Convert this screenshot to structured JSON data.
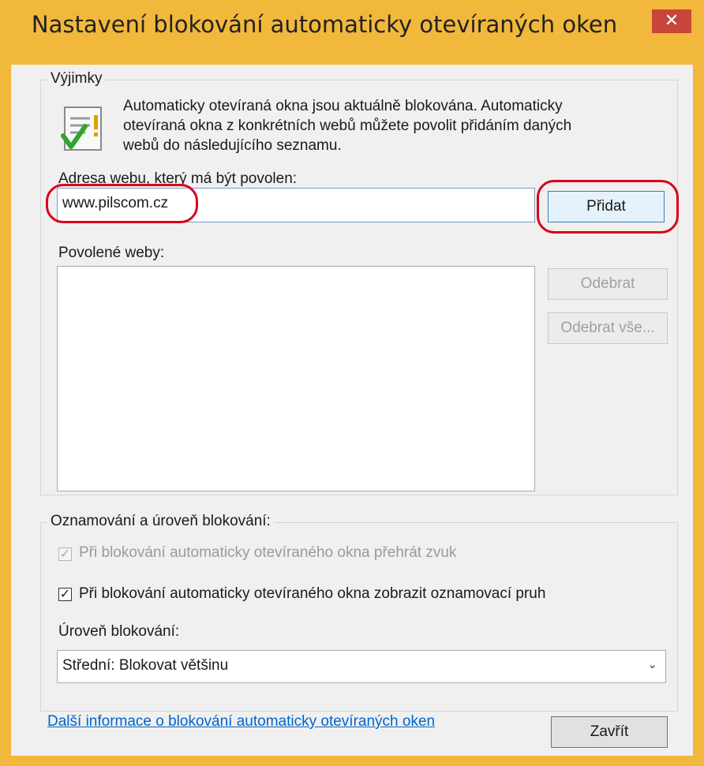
{
  "window": {
    "title": "Nastavení blokování automaticky otevíraných oken",
    "close_label": "✕"
  },
  "exceptions": {
    "legend": "Výjimky",
    "info_line1": "Automaticky otevíraná okna jsou aktuálně blokována. Automaticky",
    "info_line2": "otevíraná okna z konkrétních webů můžete povolit přidáním daných",
    "info_line3": "webů do následujícího seznamu.",
    "address_label": "Adresa webu, který má být povolen:",
    "address_value": "www.pilscom.cz",
    "add_label": "Přidat",
    "allowed_label": "Povolené weby:",
    "allowed_sites": [],
    "remove_label": "Odebrat",
    "remove_all_label": "Odebrat vše..."
  },
  "notifications": {
    "legend": "Oznamování a úroveň blokování:",
    "play_sound_label": "Při blokování automaticky otevíraného okna přehrát zvuk",
    "play_sound_checked": true,
    "show_bar_label": "Při blokování automaticky otevíraného okna zobrazit oznamovací pruh",
    "show_bar_checked": true,
    "level_label": "Úroveň blokování:",
    "level_value": "Střední: Blokovat většinu"
  },
  "footer": {
    "more_info_link": "Další informace o blokování automaticky otevíraných oken",
    "close_label": "Zavřít"
  },
  "colors": {
    "frame": "#f2b83b",
    "close": "#c7453a",
    "annotation": "#d9001b",
    "link": "#0066cc"
  }
}
